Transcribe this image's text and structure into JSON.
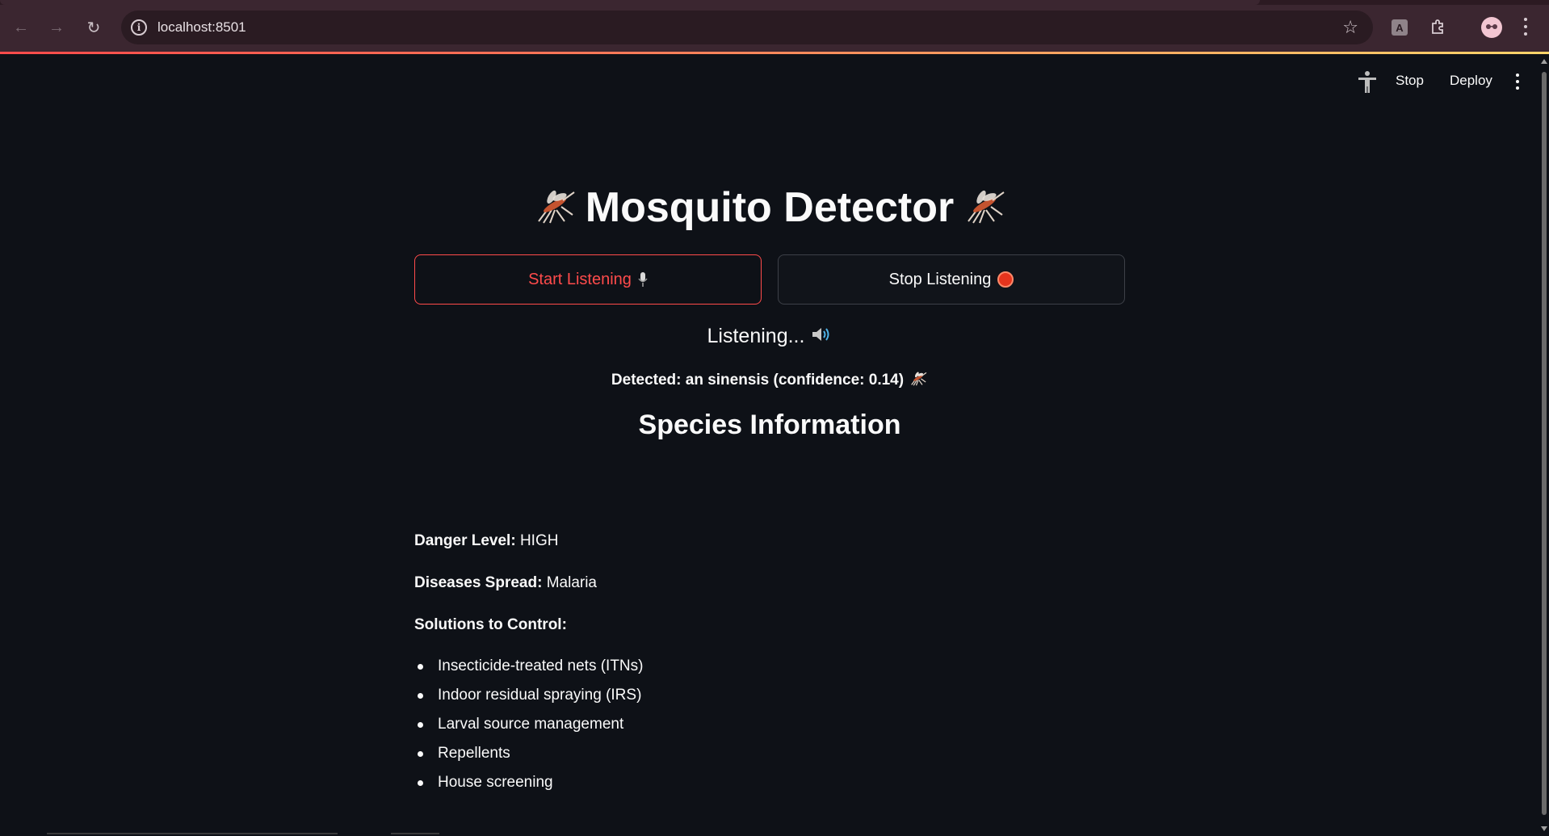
{
  "browser": {
    "url": "localhost:8501",
    "avatar_initials": "👓"
  },
  "header": {
    "stop_label": "Stop",
    "deploy_label": "Deploy"
  },
  "main": {
    "title": "Mosquito Detector",
    "start_button_label": "Start Listening",
    "stop_button_label": "Stop Listening",
    "status_text": "Listening...",
    "detected_text": "Detected: an sinensis (confidence: 0.14)",
    "species_heading": "Species Information",
    "danger_label": "Danger Level:",
    "danger_value": "HIGH",
    "diseases_label": "Diseases Spread:",
    "diseases_value": "Malaria",
    "solutions_label": "Solutions to Control:",
    "solutions": [
      "Insecticide-treated nets (ITNs)",
      "Indoor residual spraying (IRS)",
      "Larval source management",
      "Repellents",
      "House screening"
    ]
  },
  "colors": {
    "background": "#0e1117",
    "accent": "#ff4b4b",
    "chrome": "#3b2630"
  }
}
